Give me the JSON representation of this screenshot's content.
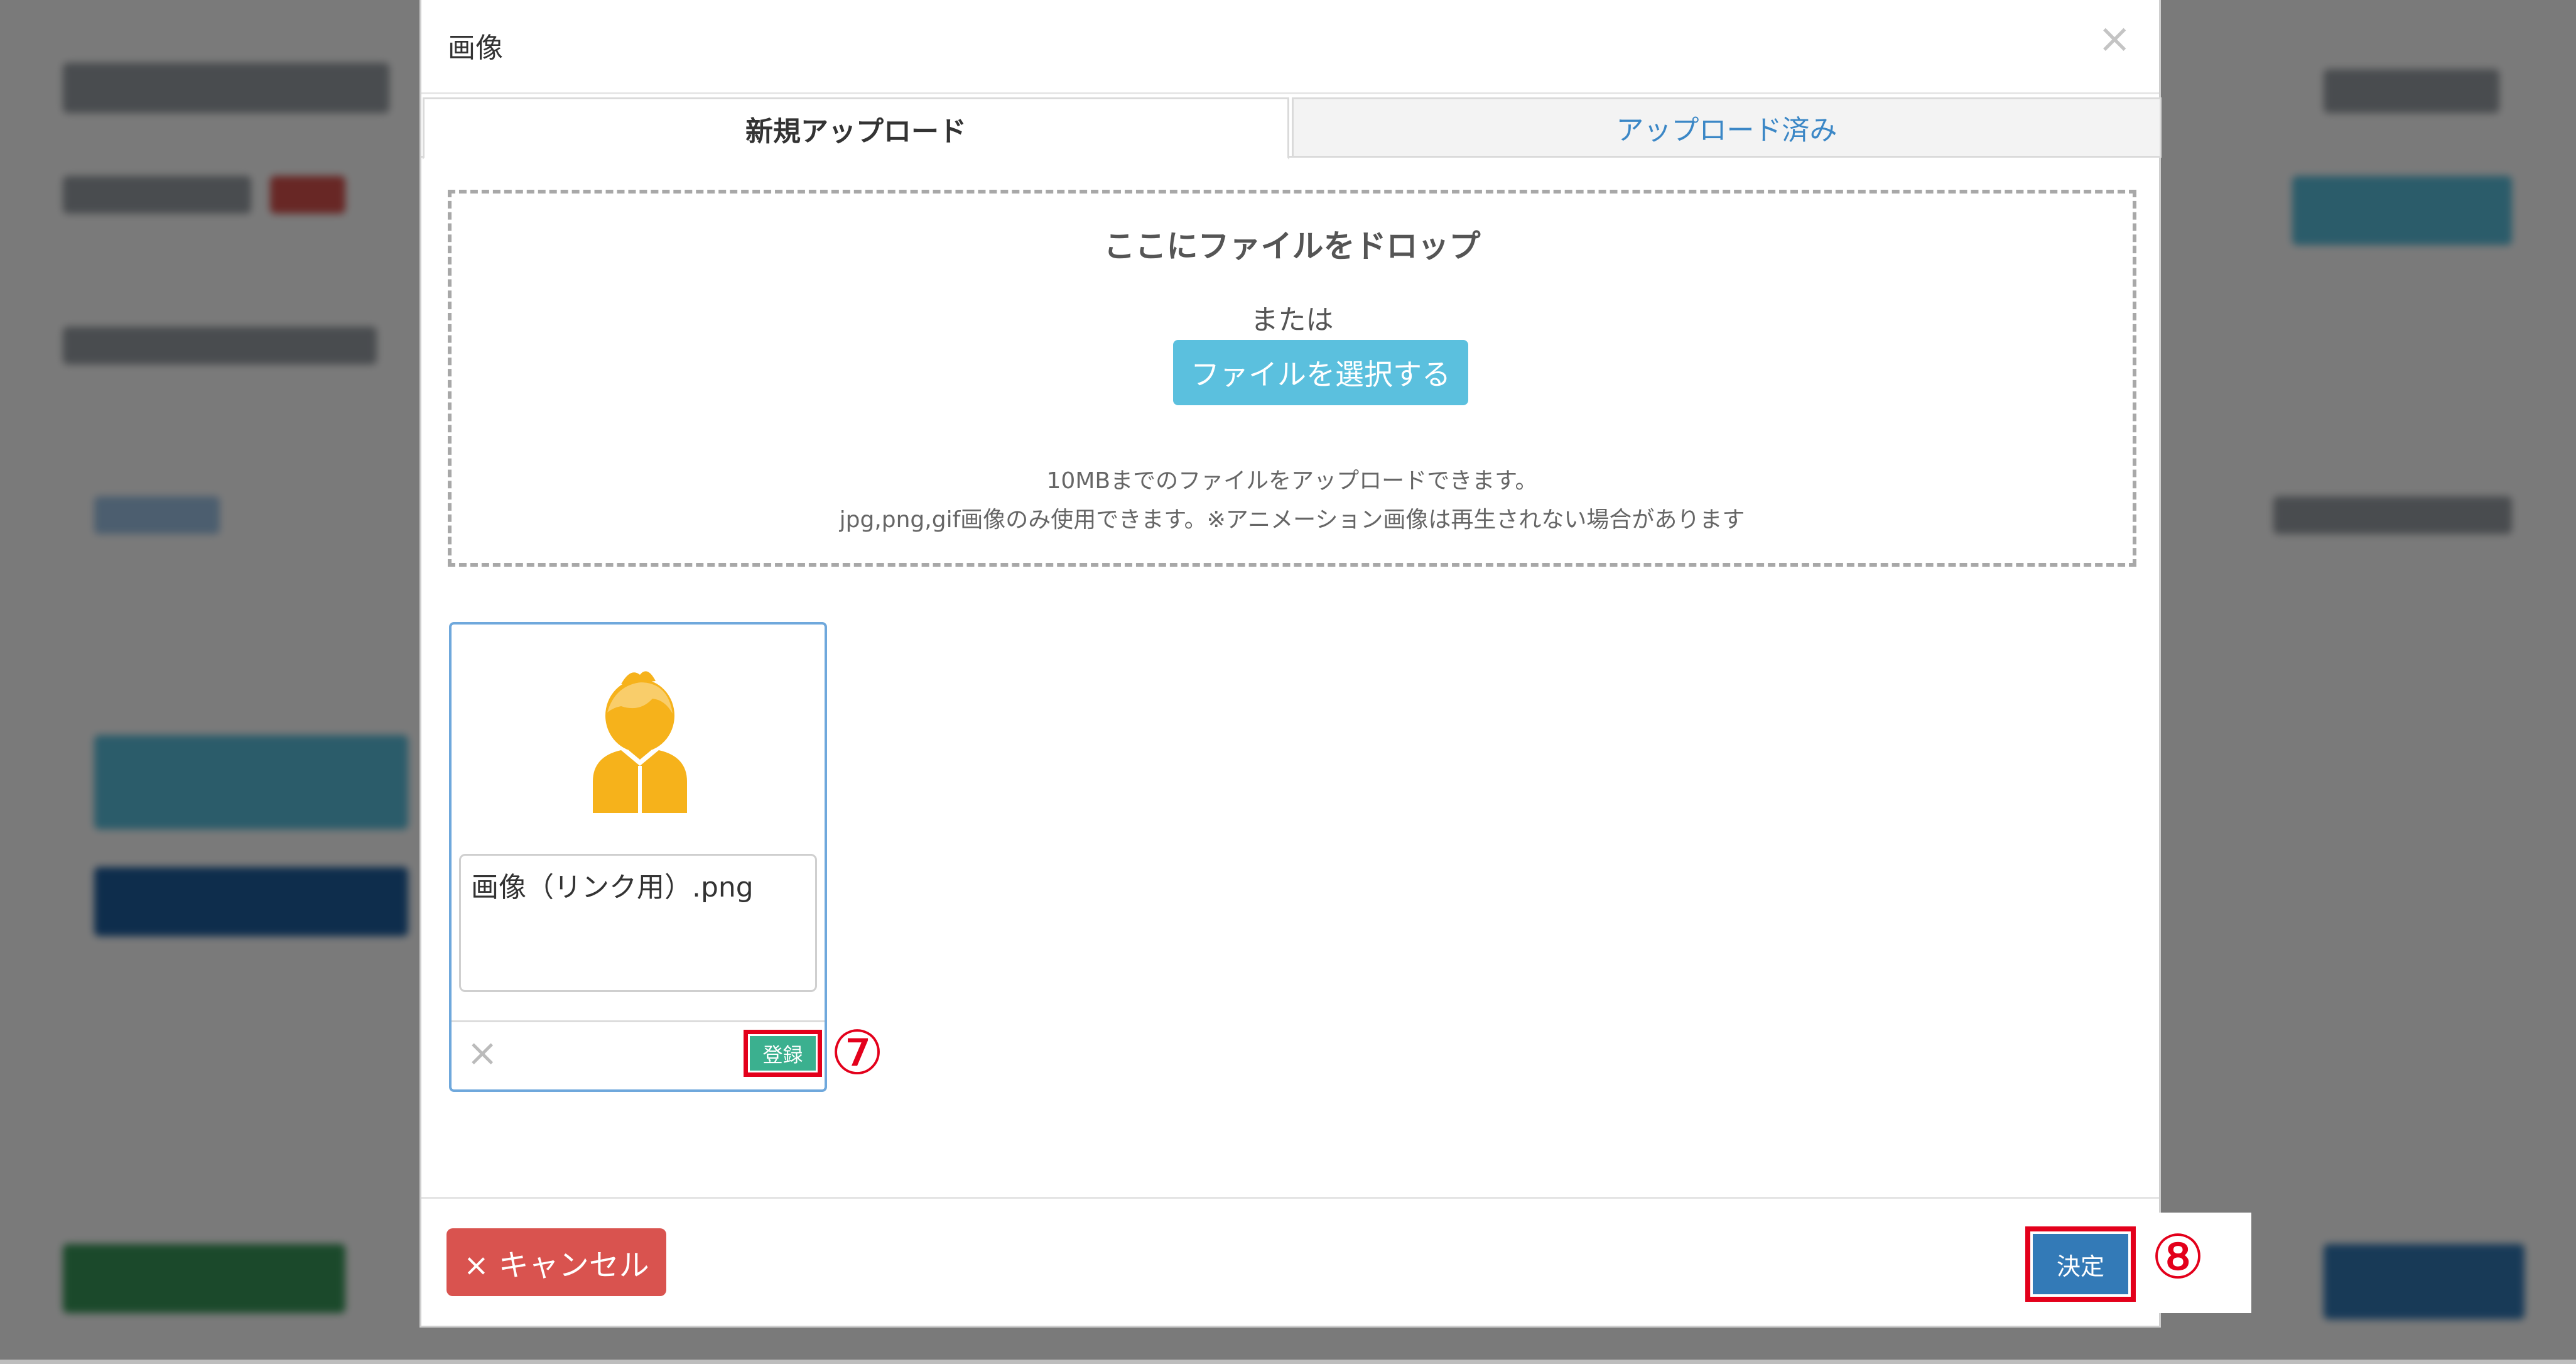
{
  "modal": {
    "title": "画像",
    "close_icon": "close-icon"
  },
  "tabs": [
    {
      "label": "新規アップロード",
      "active": true
    },
    {
      "label": "アップロード済み",
      "active": false
    }
  ],
  "dropzone": {
    "title": "ここにファイルをドロップ",
    "or_text": "または",
    "select_button": "ファイルを選択する",
    "note_size": "10MBまでのファイルをアップロードできます。",
    "note_types": "jpg,png,gif画像のみ使用できます。※アニメーション画像は再生されない場合があります"
  },
  "file_card": {
    "avatar_icon": "user-avatar-icon",
    "filename": "画像（リンク用）.png",
    "remove_icon": "close-icon",
    "register_button": "登録",
    "callout": "⑦"
  },
  "footer": {
    "cancel_button": "× キャンセル",
    "confirm_button": "決定",
    "callout": "⑧"
  },
  "colors": {
    "select_button": "#5bc0de",
    "register_button": "#3bb08f",
    "cancel_button": "#d9534f",
    "confirm_button": "#337ab7",
    "highlight": "#e3001b",
    "avatar": "#f6b21b"
  }
}
